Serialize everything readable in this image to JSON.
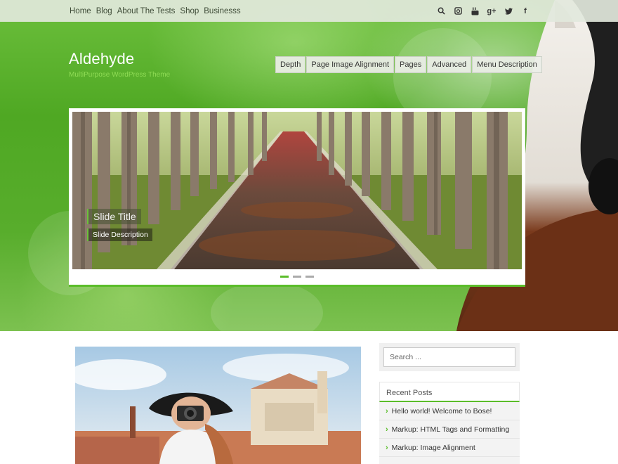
{
  "topbar": {
    "nav": [
      "Home",
      "Blog",
      "About The Tests",
      "Shop",
      "Businesss"
    ],
    "social_icons": [
      "search-icon",
      "instagram-icon",
      "youtube-icon",
      "google-plus-icon",
      "twitter-icon",
      "facebook-icon"
    ]
  },
  "brand": {
    "title": "Aldehyde",
    "tagline": "MultiPurpose WordPress Theme"
  },
  "main_menu": [
    "Depth",
    "Page Image Alignment",
    "Pages",
    "Advanced",
    "Menu Description"
  ],
  "slider": {
    "slide_title": "Slide Title",
    "slide_description": "Slide Description",
    "dots": 3,
    "active_dot": 0
  },
  "sidebar": {
    "search_placeholder": "Search ...",
    "recent_posts_title": "Recent Posts",
    "recent_posts": [
      "Hello world! Welcome to Bose!",
      "Markup: HTML Tags and Formatting",
      "Markup: Image Alignment"
    ]
  },
  "colors": {
    "accent": "#5bbd2a",
    "tagline": "#8fdc55"
  }
}
